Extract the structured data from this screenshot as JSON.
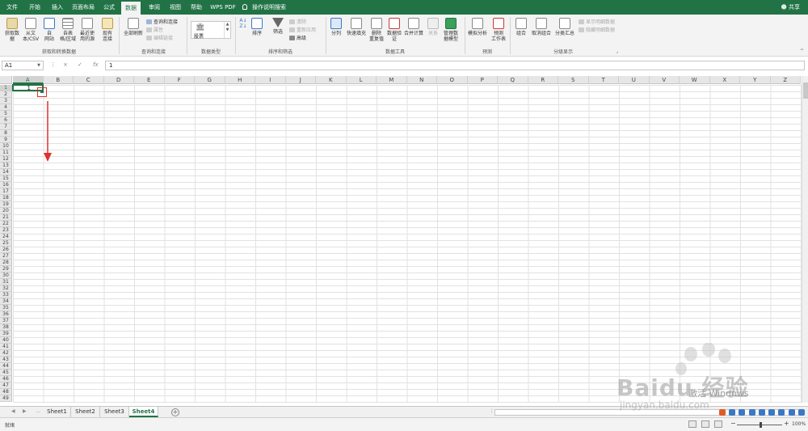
{
  "tabs": [
    {
      "label": "文件"
    },
    {
      "label": "开始"
    },
    {
      "label": "插入"
    },
    {
      "label": "页面布局"
    },
    {
      "label": "公式"
    },
    {
      "label": "数据"
    },
    {
      "label": "审阅"
    },
    {
      "label": "视图"
    },
    {
      "label": "帮助"
    },
    {
      "label": "WPS PDF"
    }
  ],
  "search_tab": "操作说明搜索",
  "share": "共享",
  "ribbon": {
    "get_data": {
      "buttons": [
        {
          "label": "获取数\n据"
        },
        {
          "label": "从文\n本/CSV"
        },
        {
          "label": "自\n网站"
        },
        {
          "label": "自表\n格/区域"
        },
        {
          "label": "最近使\n用的源"
        },
        {
          "label": "现有\n连接"
        }
      ],
      "group_label": "获取和转换数据"
    },
    "queries": {
      "refresh": "全部刷新",
      "items": [
        "查询和连接",
        "属性",
        "编辑链接"
      ],
      "group_label": "查询和连接"
    },
    "data_types": {
      "label": "股票",
      "group_label": "数据类型"
    },
    "sort_filter": {
      "sort": "排序",
      "filter": "筛选",
      "items": [
        "清除",
        "重新应用",
        "高级"
      ],
      "group_label": "排序和筛选"
    },
    "data_tools": {
      "buttons": [
        {
          "label": "分列"
        },
        {
          "label": "快速填充"
        },
        {
          "label": "删除\n重复值"
        },
        {
          "label": "数据验\n证"
        },
        {
          "label": "合并计算"
        },
        {
          "label": "关系"
        },
        {
          "label": "管理数\n据模型"
        }
      ],
      "group_label": "数据工具"
    },
    "forecast": {
      "buttons": [
        {
          "label": "模拟分析"
        },
        {
          "label": "预测\n工作表"
        }
      ],
      "group_label": "预测"
    },
    "outline": {
      "buttons": [
        {
          "label": "组合"
        },
        {
          "label": "取消组合"
        },
        {
          "label": "分类汇总"
        }
      ],
      "items": [
        "显示明细数据",
        "隐藏明细数据"
      ],
      "group_label": "分级显示"
    }
  },
  "formula_bar": {
    "name_box": "A1",
    "cancel": "×",
    "enter": "✓",
    "fx": "fx",
    "value": "1"
  },
  "columns": [
    "A",
    "B",
    "C",
    "D",
    "E",
    "F",
    "G",
    "H",
    "I",
    "J",
    "K",
    "L",
    "M",
    "N",
    "O",
    "P",
    "Q",
    "R",
    "S",
    "T",
    "U",
    "V",
    "W",
    "X",
    "Y",
    "Z"
  ],
  "rows": [
    "1",
    "2",
    "3",
    "4",
    "5",
    "6",
    "7",
    "8",
    "9",
    "10",
    "11",
    "12",
    "13",
    "14",
    "15",
    "16",
    "17",
    "18",
    "19",
    "20",
    "21",
    "22",
    "23",
    "24",
    "25",
    "26",
    "27",
    "28",
    "29",
    "30",
    "31",
    "32",
    "33",
    "34",
    "35",
    "36",
    "37",
    "38",
    "39",
    "40",
    "41",
    "42",
    "43",
    "44",
    "45",
    "46",
    "47",
    "48",
    "49"
  ],
  "cell_a1": "1",
  "sheets": [
    "Sheet1",
    "Sheet2",
    "Sheet3",
    "Sheet4"
  ],
  "active_sheet": "Sheet4",
  "status": "就绪",
  "zoom": "100%",
  "watermark": {
    "brand": "Baidu 经验",
    "url": "jingyan.baidu.com",
    "activate": "激活 Windows"
  },
  "colors": {
    "accent": "#217346",
    "annotation": "#e03030"
  }
}
